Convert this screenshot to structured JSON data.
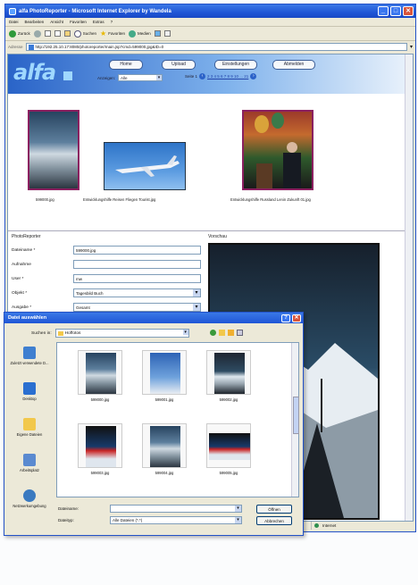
{
  "window": {
    "title": "alfa PhotoReporter - Microsoft Internet Explorer by Wandela",
    "menu": [
      "Datei",
      "Bearbeiten",
      "Ansicht",
      "Favoriten",
      "Extras",
      "?"
    ],
    "toolbar": {
      "back": "Zurück",
      "search": "Suchen",
      "favorites": "Favoriten",
      "media": "Medien"
    },
    "address_label": "Adresse",
    "address_value": "http://192.25.10.17:8080/photoreporter/main.jsp?cmd=599000.jpg&ID=0",
    "status_zone": "Internet",
    "buttons": {
      "minimize": "_",
      "maximize": "□",
      "close": "✕"
    }
  },
  "app": {
    "logo": "alfa",
    "nav": [
      "Home",
      "Upload",
      "Einstellungen",
      "Abmelden"
    ],
    "filter_label": "Anzeigen:",
    "filter_value": "Alle",
    "page_label": "Seite 1",
    "page_links": "2 3 4 5 6 7 8 9 10 ... 21",
    "thumbnails": [
      {
        "caption": "599000.jpg"
      },
      {
        "caption": "Entwicklungshilfe Reisen Fliegen Tourist.jpg"
      },
      {
        "caption": "Entwicklungshilfe Russland Lenin Zukunft 01.jpg"
      }
    ],
    "form": {
      "section": "PhotoReporter",
      "fields": [
        {
          "label": "Dateiname *",
          "value": "599000.jpg",
          "dropdown": false
        },
        {
          "label": "Aufnahme",
          "value": "",
          "dropdown": false
        },
        {
          "label": "User *",
          "value": "mw",
          "dropdown": false
        },
        {
          "label": "Objekt *",
          "value": "Tagesbild Buch",
          "dropdown": true
        },
        {
          "label": "Ausgabe *",
          "value": "Gesamt",
          "dropdown": true
        }
      ]
    },
    "preview_label": "Vorschau"
  },
  "dialog": {
    "title": "Datei auswählen",
    "look_in_label": "Suchen in:",
    "look_in_value": "Hoffotos",
    "places": [
      "Zuletzt verwendete D...",
      "Desktop",
      "Eigene Dateien",
      "Arbeitsplatz",
      "Netzwerkumgebung"
    ],
    "files": [
      "599000.jpg",
      "599001.jpg",
      "599002.jpg",
      "599003.jpg",
      "599004.jpg",
      "599005.jpg"
    ],
    "filename_label": "Dateiname:",
    "filename_value": "",
    "filetype_label": "Dateityp:",
    "filetype_value": "Alle Dateien (*.*)",
    "open_button": "Öffnen",
    "cancel_button": "Abbrechen",
    "buttons": {
      "help": "?",
      "close": "✕"
    }
  }
}
